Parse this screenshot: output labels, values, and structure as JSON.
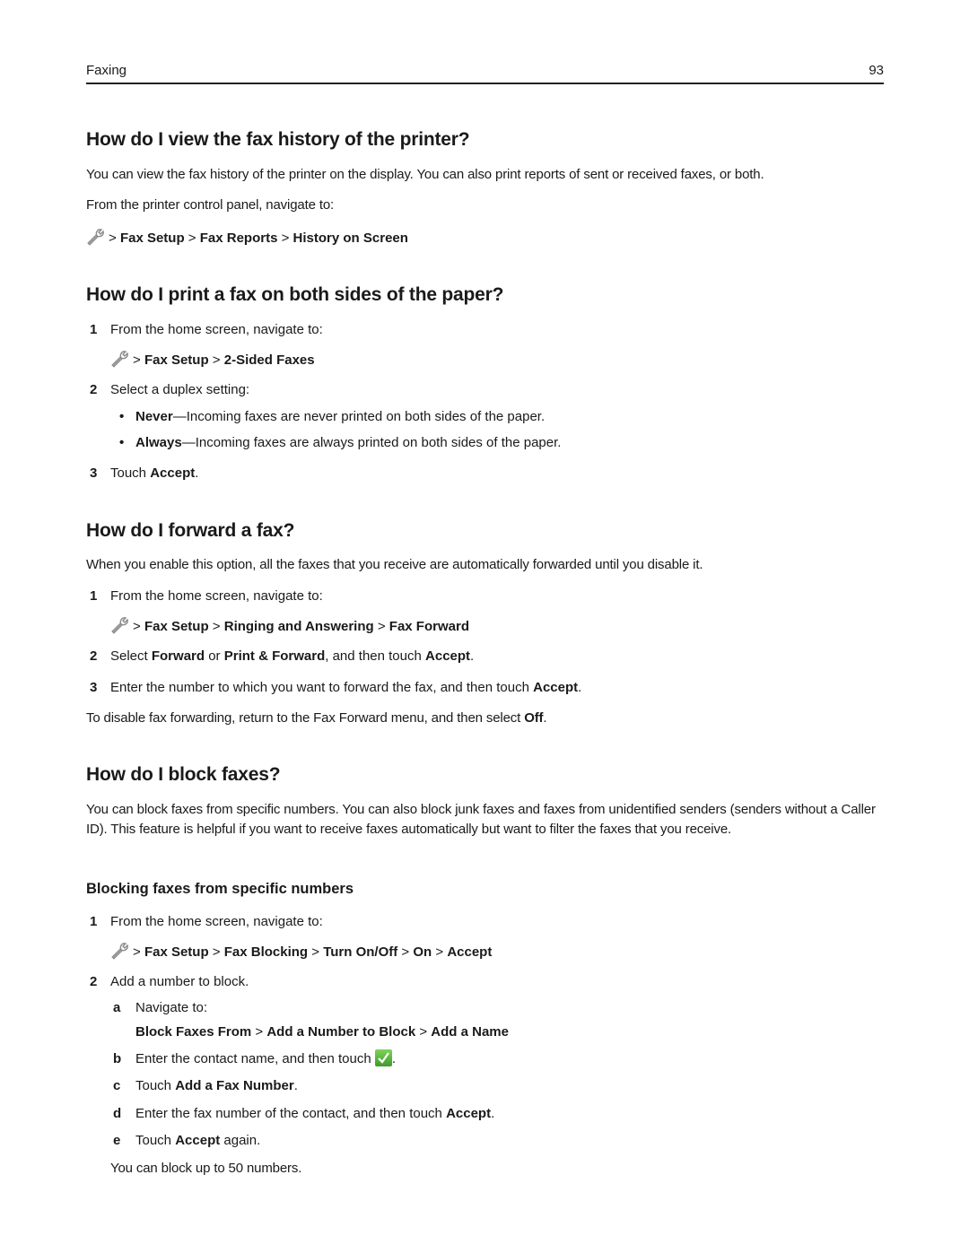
{
  "header": {
    "section": "Faxing",
    "page_number": "93"
  },
  "sections": {
    "history": {
      "title": "How do I view the fax history of the printer?",
      "para1": "You can view the fax history of the printer on the display. You can also print reports of sent or received faxes, or both.",
      "para2": "From the printer control panel, navigate to:",
      "path": [
        "Fax Setup",
        "Fax Reports",
        "History on Screen"
      ]
    },
    "two_sided": {
      "title": "How do I print a fax on both sides of the paper?",
      "step1": {
        "num": "1",
        "text": "From the home screen, navigate to:"
      },
      "path": [
        "Fax Setup",
        "2-Sided Faxes"
      ],
      "step2": {
        "num": "2",
        "text": "Select a duplex setting:"
      },
      "bullets": [
        {
          "term": "Never",
          "text": "—Incoming faxes are never printed on both sides of the paper."
        },
        {
          "term": "Always",
          "text": "—Incoming faxes are always printed on both sides of the paper."
        }
      ],
      "step3": {
        "num": "3",
        "pre": "Touch ",
        "bold": "Accept",
        "post": "."
      }
    },
    "forward": {
      "title": "How do I forward a fax?",
      "intro": "When you enable this option, all the faxes that you receive are automatically forwarded until you disable it.",
      "step1": {
        "num": "1",
        "text": "From the home screen, navigate to:"
      },
      "path": [
        "Fax Setup",
        "Ringing and Answering",
        "Fax Forward"
      ],
      "step2": {
        "num": "2",
        "t1": "Select ",
        "b1": "Forward",
        "t2": " or ",
        "b2": "Print & Forward",
        "t3": ", and then touch ",
        "b3": "Accept",
        "t4": "."
      },
      "step3": {
        "num": "3",
        "t1": "Enter the number to which you want to forward the fax, and then touch ",
        "b1": "Accept",
        "t2": "."
      },
      "outro": {
        "t1": "To disable fax forwarding, return to the Fax Forward menu, and then select ",
        "b1": "Off",
        "t2": "."
      }
    },
    "block": {
      "title": "How do I block faxes?",
      "intro": "You can block faxes from specific numbers. You can also block junk faxes and faxes from unidentified senders (senders without a Caller ID). This feature is helpful if you want to receive faxes automatically but want to filter the faxes that you receive.",
      "subtitle": "Blocking faxes from specific numbers",
      "step1": {
        "num": "1",
        "text": "From the home screen, navigate to:"
      },
      "path": [
        "Fax Setup",
        "Fax Blocking",
        "Turn On/Off",
        "On",
        "Accept"
      ],
      "step2": {
        "num": "2",
        "text": "Add a number to block."
      },
      "sub_a": {
        "letter": "a",
        "text": "Navigate to:"
      },
      "sub_a_path": [
        "Block Faxes From",
        "Add a Number to Block",
        "Add a Name"
      ],
      "sub_b": {
        "letter": "b",
        "text": "Enter the contact name, and then touch ",
        "post": "."
      },
      "sub_c": {
        "letter": "c",
        "pre": "Touch ",
        "bold": "Add a Fax Number",
        "post": "."
      },
      "sub_d": {
        "letter": "d",
        "pre": "Enter the fax number of the contact, and then touch ",
        "bold": "Accept",
        "post": "."
      },
      "sub_e": {
        "letter": "e",
        "pre": "Touch ",
        "bold": "Accept",
        "post": " again."
      },
      "note": "You can block up to 50 numbers."
    }
  },
  "separator": ">",
  "icons": {
    "settings": "wrench-icon",
    "confirm": "green-checkmark-icon"
  }
}
